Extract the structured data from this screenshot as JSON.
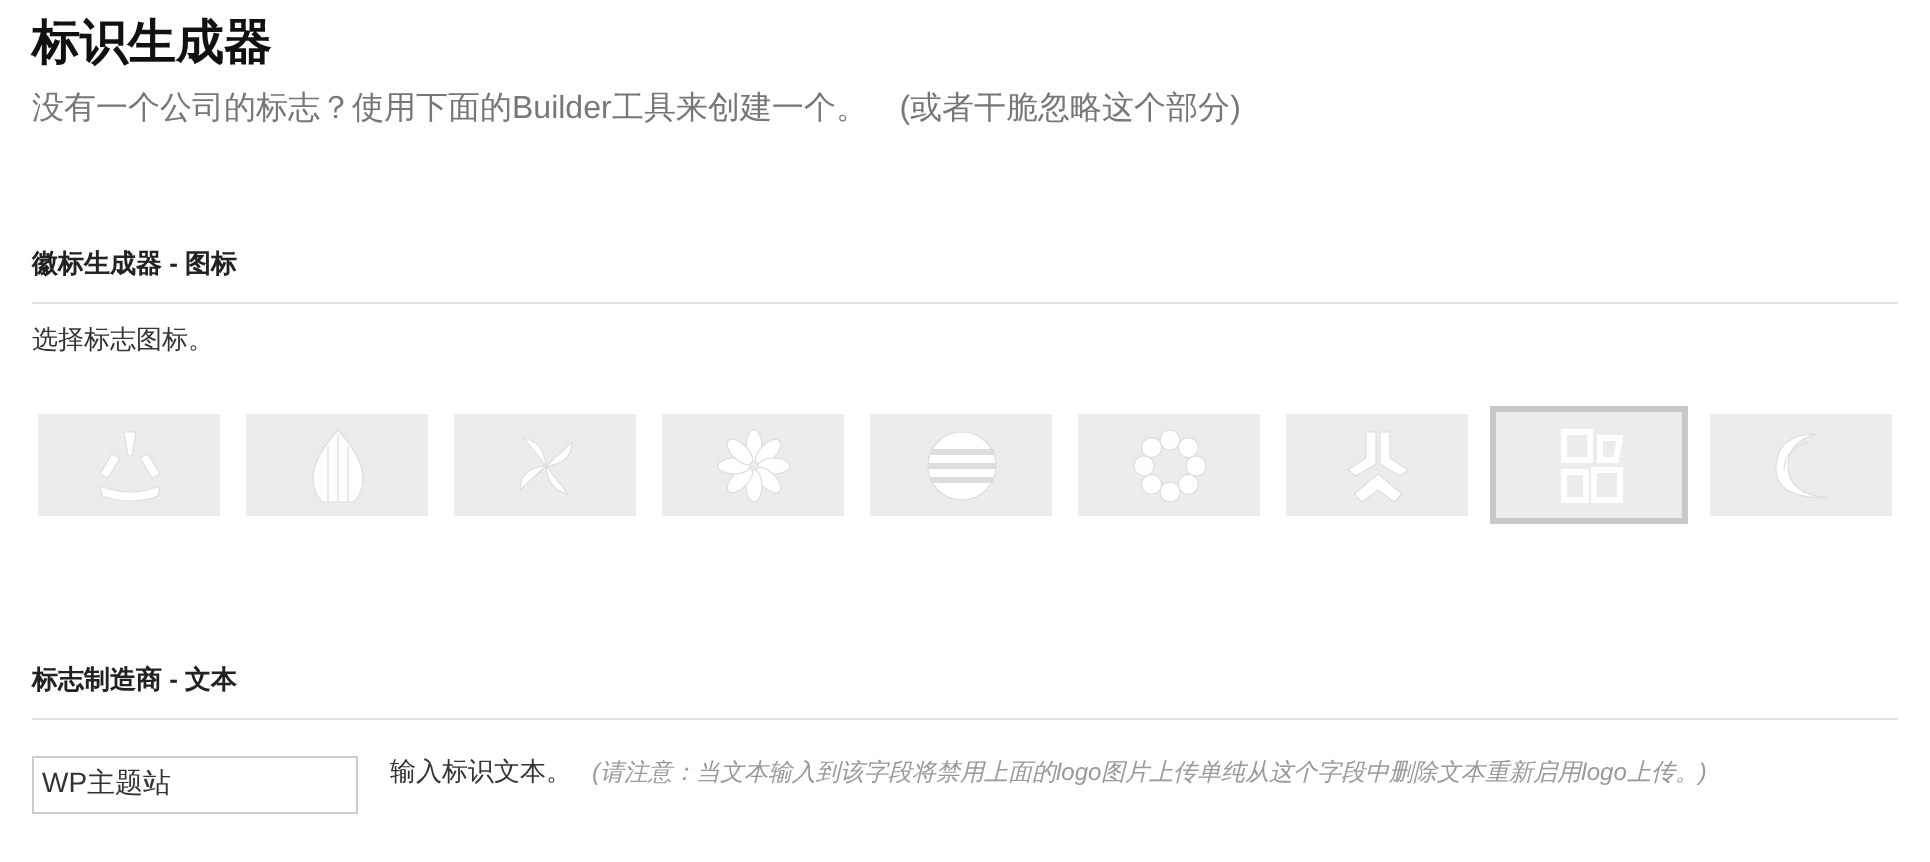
{
  "title": "标识生成器",
  "subtitle": "没有一个公司的标志？使用下面的Builder工具来创建一个。　(或者干脆忽略这个部分)",
  "icon_section": {
    "heading": "徽标生成器 - 图标",
    "instruction": "选择标志图标。",
    "icons": [
      {
        "kind": "tri-arc",
        "selected": false
      },
      {
        "kind": "leaf",
        "selected": false
      },
      {
        "kind": "pinwheel",
        "selected": false
      },
      {
        "kind": "flower",
        "selected": false
      },
      {
        "kind": "striped-globe",
        "selected": false
      },
      {
        "kind": "petal-ring",
        "selected": false
      },
      {
        "kind": "tri-block",
        "selected": false
      },
      {
        "kind": "squares",
        "selected": true
      },
      {
        "kind": "swirl",
        "selected": false
      }
    ]
  },
  "text_section": {
    "heading": "标志制造商 - 文本",
    "field": {
      "value": "WP主题站"
    },
    "label": "输入标识文本。",
    "note": "(请注意：当文本输入到该字段将禁用上面的logo图片上传单纯从这个字段中删除文本重新启用logo上传。)"
  }
}
